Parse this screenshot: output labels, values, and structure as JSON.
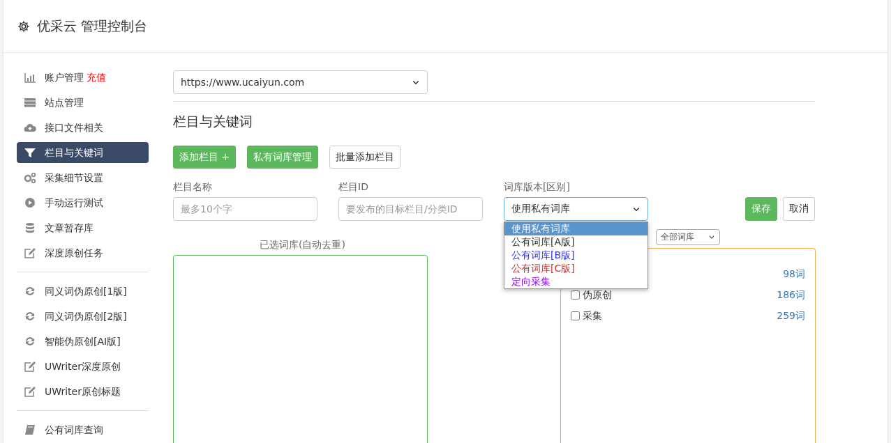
{
  "header": {
    "title": "优采云 管理控制台"
  },
  "sidebar": {
    "groups": [
      {
        "items": [
          {
            "label": "账户管理",
            "badge": "充值",
            "selected": false
          },
          {
            "label": "站点管理",
            "selected": false
          },
          {
            "label": "接口文件相关",
            "selected": false
          },
          {
            "label": "栏目与关键词",
            "selected": true
          },
          {
            "label": "采集细节设置",
            "selected": false
          },
          {
            "label": "手动运行测试",
            "selected": false
          },
          {
            "label": "文章暂存库",
            "selected": false
          },
          {
            "label": "深度原创任务",
            "selected": false
          }
        ]
      },
      {
        "items": [
          {
            "label": "同义词伪原创[1版]",
            "selected": false
          },
          {
            "label": "同义词伪原创[2版]",
            "selected": false
          },
          {
            "label": "智能伪原创[AI版]",
            "selected": false
          },
          {
            "label": "UWriter深度原创",
            "selected": false
          },
          {
            "label": "UWriter原创标题",
            "selected": false
          }
        ]
      },
      {
        "items": [
          {
            "label": "公有词库查询",
            "selected": false
          }
        ]
      }
    ]
  },
  "site_select": {
    "value": "https://www.ucaiyun.com"
  },
  "section_title": "栏目与关键词",
  "toolbar": [
    {
      "label": "添加栏目 +",
      "kind": "success"
    },
    {
      "label": "私有词库管理",
      "kind": "success"
    },
    {
      "label": "批量添加栏目",
      "kind": "outline"
    }
  ],
  "form": {
    "fields": [
      {
        "label": "栏目名称",
        "placeholder": "最多10个字"
      },
      {
        "label": "栏目ID",
        "placeholder": "要发布的目标栏目/分类ID"
      }
    ],
    "library_select": {
      "label": "词库版本[区别]",
      "value": "使用私有词库",
      "expanded": true,
      "options": [
        {
          "label": "使用私有词库",
          "selected": true
        },
        {
          "label": "公有词库[A版]",
          "selected": false
        },
        {
          "label": "公有词库[B版]",
          "selected": false,
          "color": "#3333ff"
        },
        {
          "label": "公有词库[C版]",
          "selected": false,
          "color": "#cc3333"
        },
        {
          "label": "定向采集",
          "selected": false,
          "color": "#9900ff"
        }
      ]
    },
    "save": "保存",
    "cancel": "取消"
  },
  "selected_panel": {
    "title": "已选词库(自动去重)"
  },
  "library_panel": {
    "filter": "全部词库",
    "rows": [
      {
        "count": "98词"
      },
      {
        "label": "伪原创",
        "checked": false,
        "count": "186词"
      },
      {
        "label": "采集",
        "checked": false,
        "count": "259词"
      }
    ]
  }
}
